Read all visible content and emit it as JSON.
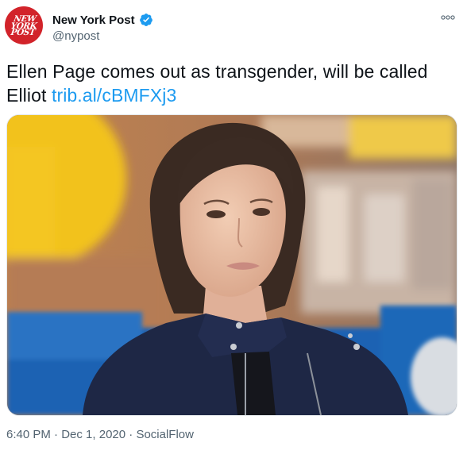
{
  "tweet": {
    "author_name": "New York Post",
    "author_handle": "@nypost",
    "avatar_logo_lines": [
      "NEW",
      "YORK",
      "POST"
    ],
    "text": "Ellen Page comes out as transgender, will be called Elliot",
    "link": "trib.al/cBMFXj3",
    "time": "6:40 PM",
    "separator": "·",
    "date": "Dec 1, 2020",
    "source": "SocialFlow"
  },
  "icons": {
    "verified": "verified-badge-icon",
    "more": "more-options-icon"
  },
  "colors": {
    "link": "#1d9bf0",
    "verified": "#1d9bf0",
    "avatar_bg": "#d2232a",
    "secondary_text": "#536471"
  }
}
